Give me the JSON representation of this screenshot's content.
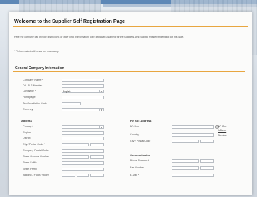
{
  "page": {
    "title": "Welcome to the Supplier Self Registration Page",
    "intro": "Here the company can provide instructions or other kind of information to be displayed as a help for the Suppliers, who want to register while filling out this page.",
    "required_note": "* Fields marked with a star are mandatory"
  },
  "general": {
    "heading": "General Company Information",
    "company_name_label": "Company Name *",
    "ds_number_label": "D-U-N-S Number",
    "language_label": "Language *",
    "language_value": "English",
    "homepage_label": "Homepage",
    "tax_label": "Tax Jurisdiction Code",
    "currency_label": "Currency"
  },
  "address": {
    "heading": "Address",
    "country_label": "Country *",
    "region_label": "Region",
    "district_label": "District",
    "city_label": "City / Postal Code *",
    "company_postal_label": "Company Postal Code",
    "street_label": "Street / House Number",
    "street_suffix_label": "Street Suffix",
    "street_prefix_label": "Street Prefix",
    "building_label": "Building / Floor / Room"
  },
  "po_box": {
    "heading": "PO Box Address",
    "po_box_label": "PO Box",
    "country_label": "Country",
    "city_label": "City / Postal Code",
    "radio_label": "PO Box",
    "without_label": "Without",
    "number_label": "Number"
  },
  "communication": {
    "heading": "Communication",
    "phone_label": "Phone Number *",
    "fax_label": "Fax Number",
    "email_label": "E-Mail *"
  }
}
